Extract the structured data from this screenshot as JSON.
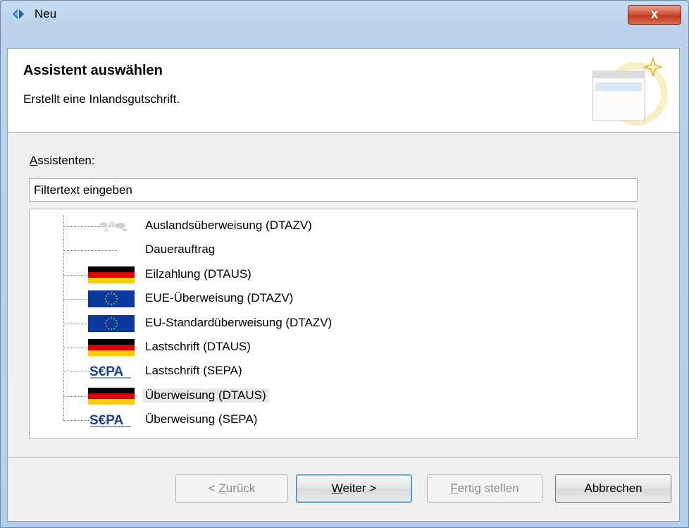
{
  "window": {
    "title": "Neu",
    "close_glyph": "x"
  },
  "header": {
    "title": "Assistent auswählen",
    "description": "Erstellt eine Inlandsgutschrift.",
    "banner_icon": "wizard-banner-icon"
  },
  "filter": {
    "label_prefix": "A",
    "label_rest": "ssistenten:",
    "value": "Filtertext eingeben"
  },
  "tree": {
    "items": [
      {
        "label": "Auslandsüberweisung (DTAZV)",
        "icon": "world-icon"
      },
      {
        "label": "Dauerauftrag",
        "icon": ""
      },
      {
        "label": "Eilzahlung (DTAUS)",
        "icon": "german-flag-icon"
      },
      {
        "label": "EUE-Überweisung (DTAZV)",
        "icon": "eu-flag-icon"
      },
      {
        "label": "EU-Standardüberweisung (DTAZV)",
        "icon": "eu-flag-icon"
      },
      {
        "label": "Lastschrift (DTAUS)",
        "icon": "german-flag-icon"
      },
      {
        "label": "Lastschrift (SEPA)",
        "icon": "sepa-logo-icon"
      },
      {
        "label": "Überweisung (DTAUS)",
        "icon": "german-flag-icon",
        "selected": true
      },
      {
        "label": "Überweisung (SEPA)",
        "icon": "sepa-logo-icon"
      }
    ],
    "sepa_logo_text": "S€PA"
  },
  "buttons": {
    "back_prefix": "< ",
    "back_mnemonic": "Z",
    "back_rest": "urück",
    "next_mnemonic": "W",
    "next_rest": "eiter >",
    "finish_mnemonic": "F",
    "finish_rest": "ertig stellen",
    "cancel": "Abbrechen"
  },
  "colors": {
    "flag_black": "#000000",
    "flag_red": "#dd0000",
    "flag_gold": "#ffce00",
    "eu_blue": "#0a3aa0",
    "sepa_blue": "#1b3f93",
    "sepa_yellow": "#f3c300"
  }
}
